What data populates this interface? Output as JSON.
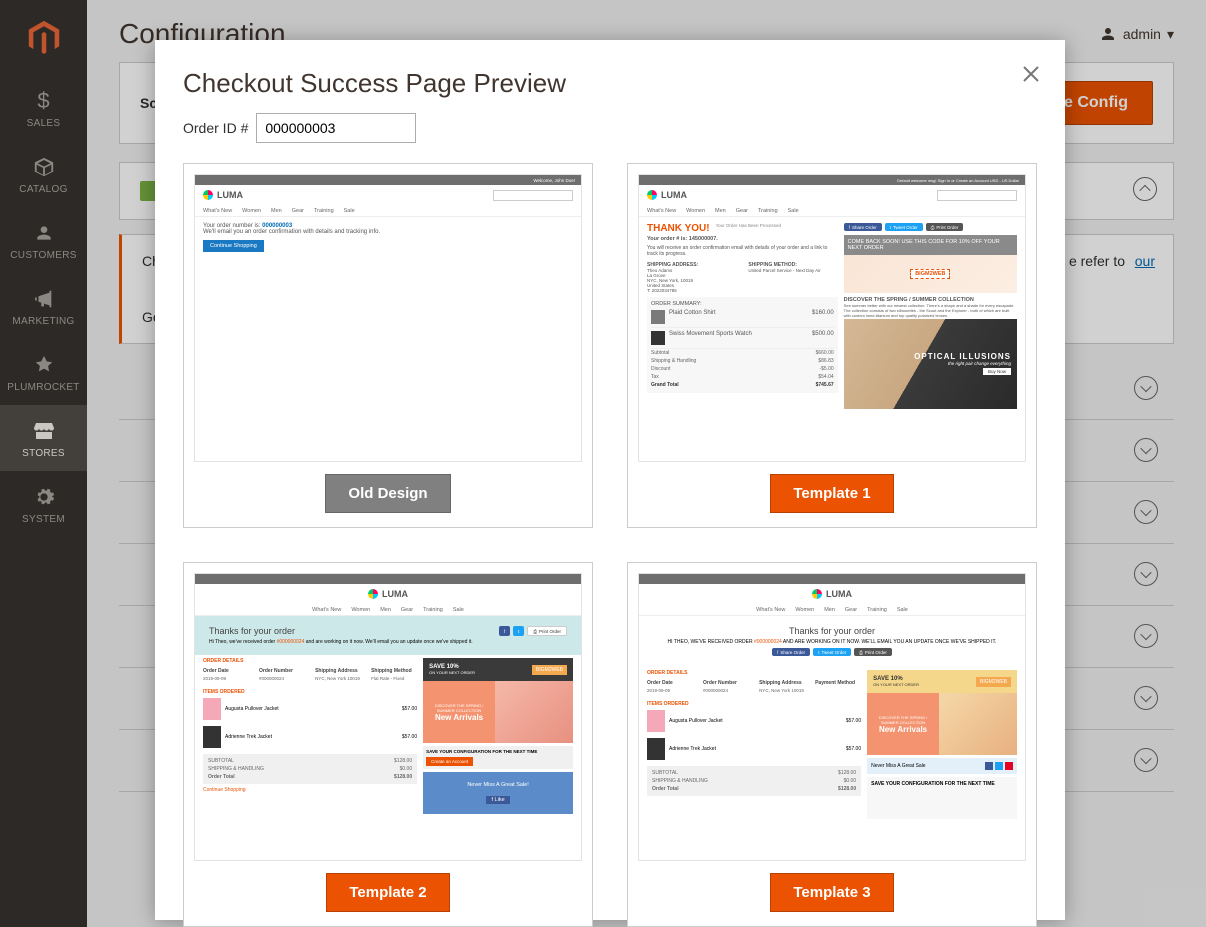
{
  "header": {
    "page_title": "Configuration",
    "user_name": "admin"
  },
  "sidebar": {
    "items": [
      {
        "label": "SALES",
        "icon": "dollar"
      },
      {
        "label": "CATALOG",
        "icon": "box"
      },
      {
        "label": "CUSTOMERS",
        "icon": "person"
      },
      {
        "label": "MARKETING",
        "icon": "megaphone"
      },
      {
        "label": "PLUMROCKET",
        "icon": "logo"
      },
      {
        "label": "STORES",
        "icon": "storefront"
      },
      {
        "label": "SYSTEM",
        "icon": "gear"
      }
    ]
  },
  "scope": {
    "label_prefix": "Sco",
    "save_button": "Save Config"
  },
  "config": {
    "row1_prefix": "Ch",
    "row1_suffix": "e refer to ",
    "row1_link": "our",
    "row2_prefix": "Ge"
  },
  "modal": {
    "title": "Checkout Success Page Preview",
    "order_label": "Order ID #",
    "order_value": "000000003",
    "templates": [
      {
        "button": "Old Design",
        "style": "gray"
      },
      {
        "button": "Template 1",
        "style": "orange"
      },
      {
        "button": "Template 2",
        "style": "orange"
      },
      {
        "button": "Template 3",
        "style": "orange"
      }
    ]
  },
  "preview": {
    "luma_brand": "LUMA",
    "nav_items": [
      "What's New",
      "Women",
      "Men",
      "Gear",
      "Training",
      "Sale"
    ],
    "old": {
      "line1": "Your order number is:",
      "order_no": "000000003",
      "line2": "We'll email you an order confirmation with details and tracking info.",
      "continue_btn": "Continue Shopping",
      "topbar_text": "Welcome, John Doe!"
    },
    "t1": {
      "topbar_text": "Default welcome msg!   Sign In   or   Create an Account   USD - US Dollar",
      "thank_you": "THANK YOU!",
      "sub": "Your Order Has Been Processed",
      "order_label": "Your order # is: 145000007.",
      "desc": "You will receive an order confirmation email with details of your order and a link to track its progress.",
      "ship_addr_h": "SHIPPING ADDRESS:",
      "ship_addr": "Theo Adams\nLa Grove\nNYC, New York, 10019\nUnited States\nT: 2022034786",
      "ship_meth_h": "SHIPPING METHOD:",
      "ship_meth": "United Parcel Service - Next Day Air",
      "summary_h": "ORDER SUMMARY:",
      "item1": "Plaid Cotton Shirt",
      "item1_price": "$160.00",
      "item2": "Swiss Movement Sports Watch",
      "item2_price": "$500.00",
      "sub_l": "Subtotal",
      "sub_v": "$660.00",
      "sh_l": "Shipping & Handling",
      "sh_v": "$86.83",
      "disc_l": "Discount",
      "disc_v": "-$5.00",
      "tax_l": "Tax",
      "tax_v": "$54.04",
      "gt_l": "Grand Total",
      "gt_v": "$745.67",
      "share_fb": "Share Order",
      "share_tw": "Tweet Order",
      "share_print": "Print Order",
      "comeback": "COME BACK SOON! USE THIS CODE FOR 10% OFF YOUR NEXT ORDER",
      "promo_code": "BIGM2WEB",
      "discover": "DISCOVER THE SPRING / SUMMER COLLECTION",
      "discover_sub": "See summer better with our newest collection. There's a shape and a shade for every escapade. The collection consists of two silhouettes - the Scout and the Explorer - both of which are built with custom lume-titanium and top quality polarized lenses.",
      "optical": "OPTICAL ILLUSIONS",
      "optical_sub": "the right pair change everything",
      "buy_now": "Buy Now"
    },
    "t23": {
      "thanks": "Thanks for your order",
      "sub2": "Hi Theo, we've received order",
      "sub2_order": "#000000024",
      "sub2b": " and are working on it now. We'll email you an update once we've shipped it.",
      "sub3": "HI THEO, WE'VE RECEIVED ORDER",
      "sub3b": "AND ARE WORKING ON IT NOW. WE'LL EMAIL YOU AN UPDATE ONCE WE'VE SHIPPED IT.",
      "share": "Share Order",
      "tweet": "Tweet Order",
      "print": "Print Order",
      "order_details_h": "ORDER DETAILS",
      "c1h": "Order Date",
      "c1v": "2019-09-09",
      "c2h": "Order Number",
      "c2v": "#000000024",
      "c3h": "Shipping Address",
      "c3v": "NYC, New York 10019",
      "c4h": "Shipping Method",
      "c4v": "Flat Rate - Fixed",
      "items_ordered_h": "ITEMS ORDERED",
      "save_pct": "SAVE 10%",
      "save_sub": "ON YOUR NEXT ORDER",
      "save_code": "BIGM2WEB",
      "arrivals": "New Arrivals",
      "arrivals_pre": "DISCOVER THE SPRING / SUMMER COLLECTION",
      "never": "Never Miss A Great Sale!",
      "never2": "Never Miss A Great Sale",
      "conf_h": "SAVE YOUR CONFIGURATION FOR THE NEXT TIME",
      "p1": "Augusta Pullover Jacket",
      "p1_price": "$57.00",
      "p2": "Adrienne Trek Jacket",
      "p2_price": "$57.00",
      "sub_l": "SUBTOTAL",
      "sub_v": "$128.00",
      "sh_l": "SHIPPING & HANDLING",
      "sh_v": "$0.00",
      "tot_l": "Order Total",
      "tot_v": "$128.00",
      "continue_link": "Continue Shopping",
      "create_btn": "Create an Account",
      "c4h_alt": "Payment Method"
    }
  }
}
